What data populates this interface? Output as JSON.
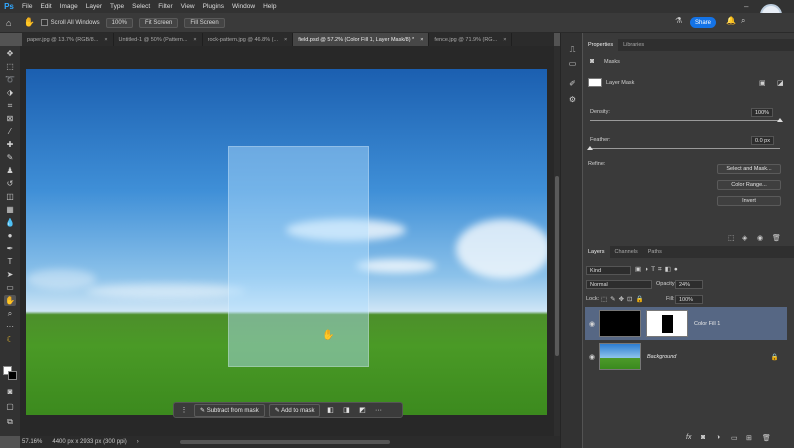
{
  "app": {
    "logo": "Ps",
    "menu": [
      "File",
      "Edit",
      "Image",
      "Layer",
      "Type",
      "Select",
      "Filter",
      "View",
      "Plugins",
      "Window",
      "Help"
    ]
  },
  "options_bar": {
    "home_icon": "home-icon",
    "hand_icon": "hand-tool-icon",
    "scroll_all_windows": "Scroll All Windows",
    "zoom_100": "100%",
    "fit_screen": "Fit Screen",
    "fill_screen": "Fill Screen",
    "share": "Share"
  },
  "doc_tabs": [
    {
      "label": "paper.jpg @ 13.7% (RGB/8...",
      "close": "×",
      "active": false
    },
    {
      "label": "Untitled-1 @ 50% (Pattern...",
      "close": "×",
      "active": false
    },
    {
      "label": "rock-pattern.jpg @ 46.8% (...",
      "close": "×",
      "active": false
    },
    {
      "label": "field.psd @ 57.2% (Color Fill 1, Layer Mask/8) *",
      "close": "×",
      "active": true
    },
    {
      "label": "fence.jpg @ 71.9% (RG...",
      "close": "×",
      "active": false
    }
  ],
  "context_bar": {
    "subtract": "Subtract from mask",
    "add": "Add to mask",
    "more": "···"
  },
  "status": {
    "zoom": "57.16%",
    "doc_size": "4400 px x 2933 px (300 ppi)"
  },
  "properties": {
    "tab_properties": "Properties",
    "tab_libraries": "Libraries",
    "masks_label": "Masks",
    "layer_mask_label": "Layer Mask",
    "density_label": "Density:",
    "density_value": "100%",
    "density_level": 1.0,
    "feather_label": "Feather:",
    "feather_value": "0.0 px",
    "feather_level": 0.0,
    "refine_label": "Refine:",
    "select_and_mask": "Select and Mask...",
    "color_range": "Color Range...",
    "invert": "Invert"
  },
  "layers": {
    "tab_layers": "Layers",
    "tab_channels": "Channels",
    "tab_paths": "Paths",
    "kind_filter": "Kind",
    "blend_mode": "Normal",
    "opacity_label": "Opacity:",
    "opacity_value": "24%",
    "lock_label": "Lock:",
    "fill_label": "Fill:",
    "fill_value": "100%",
    "items": [
      {
        "name": "Color Fill 1",
        "selected": true
      },
      {
        "name": "Background",
        "selected": false
      }
    ]
  },
  "colors": {
    "accent": "#1473e6",
    "selected_layer": "#566784"
  }
}
